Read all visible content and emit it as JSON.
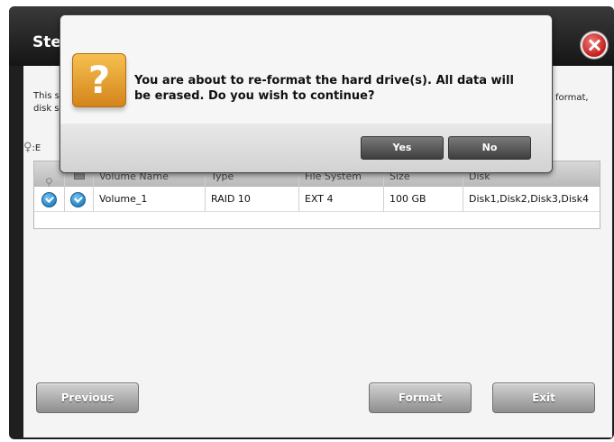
{
  "wizard": {
    "title": "Ste",
    "desc_left_1": "This s",
    "desc_left_2": "disk s",
    "desc_right": "format,",
    "key_label": ":E"
  },
  "table": {
    "headers": [
      "Volume Name",
      "Type",
      "File System",
      "Size",
      "Disk"
    ],
    "rows": [
      {
        "volume_name": "Volume_1",
        "type": "RAID 10",
        "file_system": "EXT 4",
        "size": "100 GB",
        "disk": "Disk1,Disk2,Disk3,Disk4"
      }
    ]
  },
  "buttons": {
    "previous": "Previous",
    "format": "Format",
    "exit": "Exit"
  },
  "dialog": {
    "icon_glyph": "?",
    "message": "You are about to re-format the hard drive(s). All data will be erased. Do you wish to continue?",
    "yes": "Yes",
    "no": "No"
  },
  "colors": {
    "header_bg": "#1f1f1f",
    "check_blue": "#1f7fc2",
    "close_red": "#c21e1e",
    "question_orange": "#e39a2c"
  }
}
